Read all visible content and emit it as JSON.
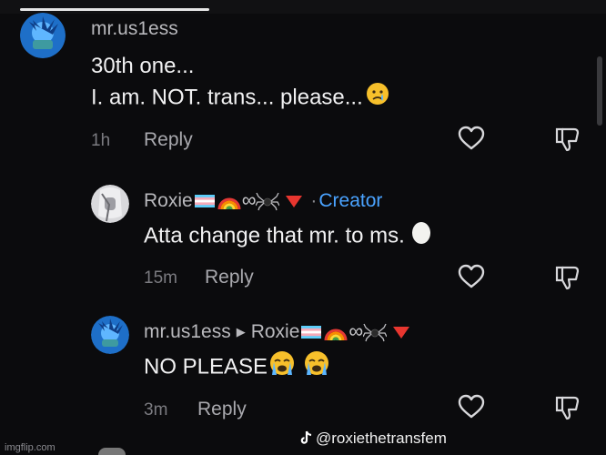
{
  "comments": [
    {
      "username": "mr.us1ess",
      "lines": [
        "30th one...",
        "I. am. NOT. trans... please..."
      ],
      "time": "1h",
      "reply_label": "Reply"
    },
    {
      "username": "Roxie",
      "badge_separator": "·",
      "creator_label": "Creator",
      "text": "Atta change that mr. to ms.",
      "time": "15m",
      "reply_label": "Reply"
    },
    {
      "username": "mr.us1ess",
      "reply_to": "Roxie",
      "text": "NO PLEASE",
      "time": "3m",
      "reply_label": "Reply"
    }
  ],
  "watermark": "@roxiethetransfem",
  "imgflip": "imgflip.com",
  "icons": [
    "heart-icon",
    "dislike-icon",
    "tiktok-logo-icon",
    "reply-arrow-icon",
    "trans-flag-icon",
    "rainbow-emoji",
    "infinity-symbol",
    "spider-emoji",
    "red-triangle-emoji",
    "crying-face-emoji",
    "egg-emoji"
  ],
  "colors": {
    "background": "#0b0b0d",
    "creator": "#4aa3ff",
    "triangle": "#e8362f"
  }
}
